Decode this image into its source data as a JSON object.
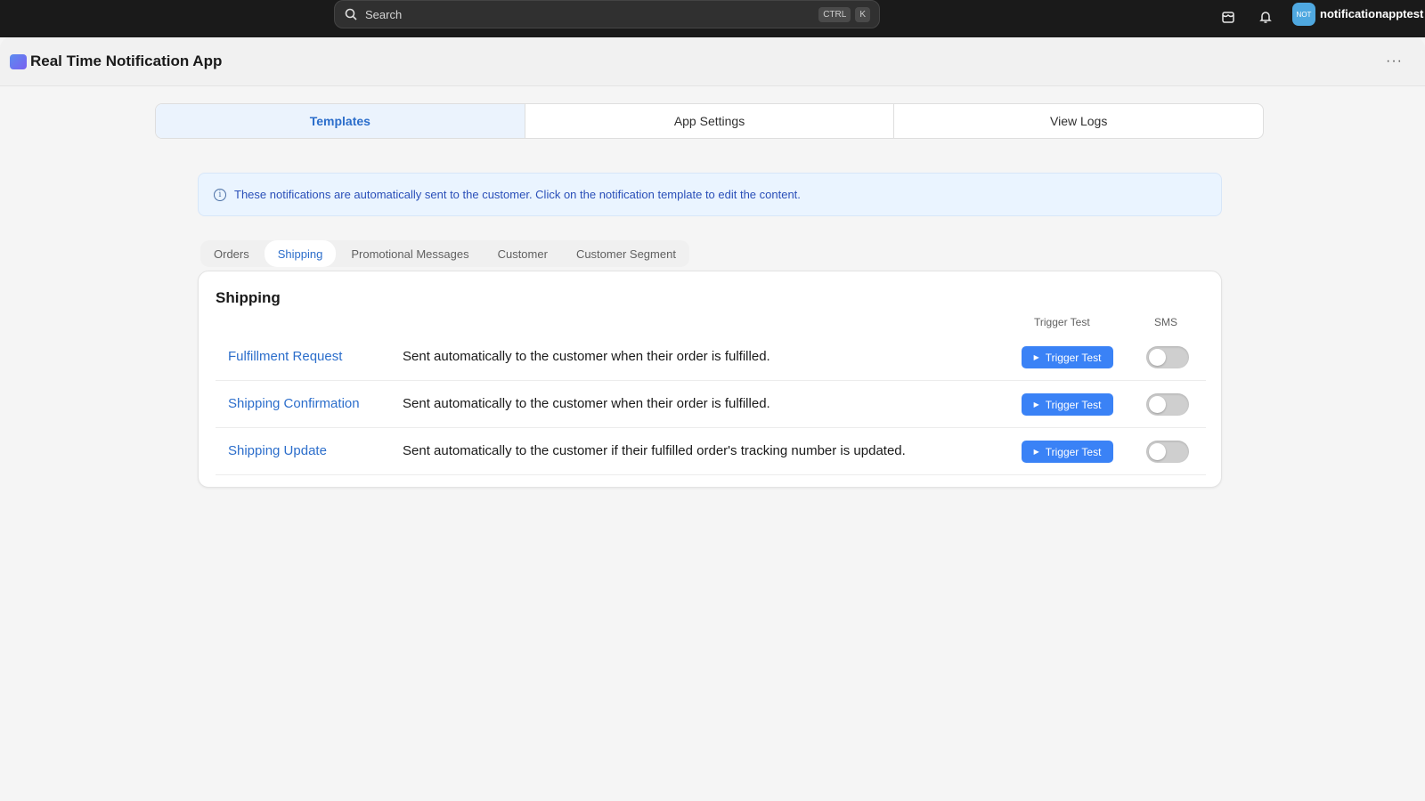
{
  "topbar": {
    "search_placeholder": "Search",
    "shortcut_key1": "CTRL",
    "shortcut_key2": "K",
    "avatar_initials": "NOT",
    "username": "notificationapptest",
    "icons": [
      "search-icon",
      "store-icon",
      "bell-icon"
    ]
  },
  "app": {
    "title": "Real Time Notification App",
    "more": "···"
  },
  "main_tabs": [
    {
      "label": "Templates",
      "active": true
    },
    {
      "label": "App Settings",
      "active": false
    },
    {
      "label": "View Logs",
      "active": false
    }
  ],
  "banner": {
    "message": "These notifications are automatically sent to the customer. Click on the notification template to edit the content.",
    "info_glyph": "i"
  },
  "sub_tabs": [
    {
      "label": "Orders",
      "active": false
    },
    {
      "label": "Shipping",
      "active": true
    },
    {
      "label": "Promotional Messages",
      "active": false
    },
    {
      "label": "Customer",
      "active": false
    },
    {
      "label": "Customer Segment",
      "active": false
    }
  ],
  "card": {
    "title": "Shipping",
    "col_trigger": "Trigger Test",
    "col_sms": "SMS",
    "rows": [
      {
        "name": "Fulfillment Request",
        "desc": "Sent automatically to the customer when their order is fulfilled.",
        "button": "Trigger Test",
        "sms_enabled": false
      },
      {
        "name": "Shipping Confirmation",
        "desc": "Sent automatically to the customer when their order is fulfilled.",
        "button": "Trigger Test",
        "sms_enabled": false
      },
      {
        "name": "Shipping Update",
        "desc": "Sent automatically to the customer if their fulfilled order's tracking number is updated.",
        "button": "Trigger Test",
        "sms_enabled": false
      }
    ]
  },
  "colors": {
    "accent": "#2c6ecb",
    "button": "#3a82f6",
    "topbar": "#1a1a1a"
  }
}
